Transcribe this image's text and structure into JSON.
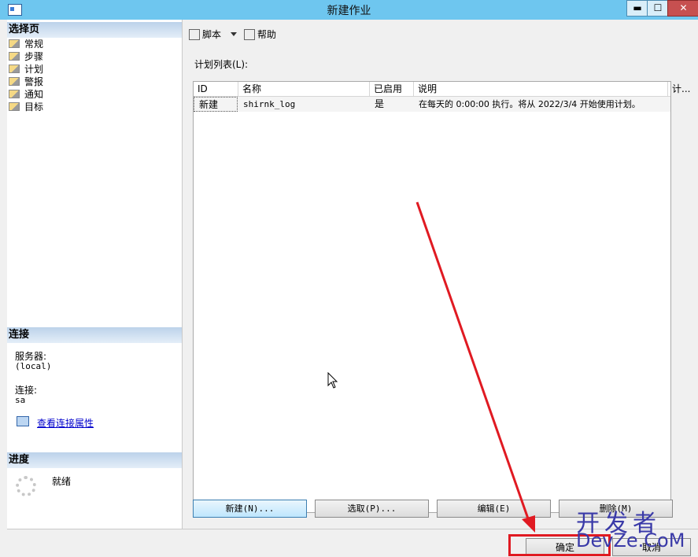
{
  "window": {
    "title": "新建作业",
    "min_glyph": "▬",
    "max_glyph": "☐",
    "close_glyph": "✕"
  },
  "sidebar": {
    "select_page_header": "选择页",
    "pages": [
      {
        "label": "常规"
      },
      {
        "label": "步骤"
      },
      {
        "label": "计划"
      },
      {
        "label": "警报"
      },
      {
        "label": "通知"
      },
      {
        "label": "目标"
      }
    ],
    "connection_header": "连接",
    "server_label": "服务器:",
    "server_value": "(local)",
    "connection_label": "连接:",
    "connection_value": "sa",
    "view_connection_link": "查看连接属性",
    "progress_header": "进度",
    "progress_status": "就绪"
  },
  "toolbar": {
    "script_label": "脚本",
    "help_label": "帮助"
  },
  "schedules": {
    "list_label": "计划列表(L):",
    "columns": [
      "ID",
      "名称",
      "已启用",
      "说明",
      "计..."
    ],
    "rows": [
      {
        "id": "新建",
        "name": "shirnk_log",
        "enabled": "是",
        "description": "在每天的 0:00:00 执行。将从 2022/3/4 开始使用计划。"
      }
    ]
  },
  "buttons": {
    "new": "新建(N)...",
    "pick": "选取(P)...",
    "edit": "编辑(E)",
    "remove": "删除(M)"
  },
  "dialog": {
    "ok": "确定",
    "cancel": "取消"
  },
  "watermark": {
    "cn": "开发者",
    "en": "DevZe.CoM"
  },
  "colors": {
    "titlebar": "#6ec6ef",
    "annotation_red": "#e01a22",
    "link": "#0000cc"
  }
}
